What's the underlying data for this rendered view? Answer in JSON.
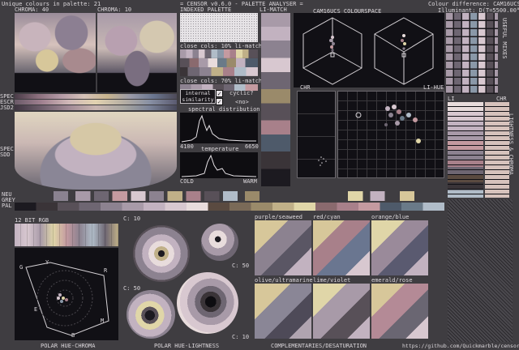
{
  "header": {
    "unique_colours": "Unique colours in palette: 21",
    "app_title": "= CENSOR v0.6.0 - PALETTE ANALYSER =",
    "colour_difference": "Colour difference: CAM16UCS",
    "illuminant": "Illuminant: D(T=5500.00°K)"
  },
  "labels": {
    "chroma40": "CHROMA: 40",
    "chroma10": "CHROMA: 10",
    "indexed_palette": "INDEXED PALETTE",
    "li_match": "LI-MATCH",
    "cam16ucs": "CAM16UCS COLOURSPACE",
    "useful_mixes": "USEFUL MIXES",
    "lightness_chroma": "LIGHTNESS & CHROMA",
    "spec": "SPEC",
    "escr": "ESCR",
    "jsd2": "JSD2",
    "spec2": "SPEC",
    "sdd": "SDD",
    "close_cols_10": "close cols: 10% li-match",
    "close_cols_70": "close cols: 70% li-match",
    "internal_similarity": "internal similarity",
    "cyclic": "cyclic?",
    "no": "<no>",
    "spectral": "spectral distribution",
    "spec_lo": "4100",
    "spec_hi": "6650",
    "temperature": "temperature",
    "cold": "COLD",
    "warm": "WARM",
    "chr": "CHR",
    "li_hue": "LI-HUE",
    "li": "LI",
    "chr2": "CHR",
    "neu": "NEU",
    "grey": "GREY",
    "pal": "PAL",
    "bit_rgb": "12 BIT RGB",
    "c10a": "C: 10",
    "c50a": "C: 50",
    "c50b": "C: 50",
    "c10b": "C: 10",
    "purple_seaweed": "purple/seaweed",
    "red_cyan": "red/cyan",
    "orange_blue": "orange/blue",
    "olive_ultramarine": "olive/ultramarine",
    "lime_violet": "lime/violet",
    "emerald_rose": "emerald/rose",
    "polar_hue_chroma": "POLAR HUE-CHROMA",
    "polar_hue_lightness": "POLAR HUE-LIGHTNESS",
    "complementaries": "COMPLEMENTARIES/DESATURATION",
    "github": "https://github.com/Quickmarble/censor",
    "wheel_g": "G",
    "wheel_y": "Y",
    "wheel_r": "R",
    "wheel_e": "E",
    "wheel_m": "M",
    "wheel_b": "B"
  },
  "palette": [
    "#1c1a20",
    "#3a3438",
    "#585058",
    "#6e6672",
    "#8c8290",
    "#a89aa8",
    "#c2b2c0",
    "#d8c8d0",
    "#e8dcdc",
    "#5a4a40",
    "#7a6a58",
    "#9a8a6a",
    "#c0b088",
    "#e0d6a8",
    "#8a6a6e",
    "#a8808a",
    "#c49aa0",
    "#4e5a6a",
    "#6a7a88",
    "#8a98a8",
    "#b0bcc8"
  ],
  "colors": {
    "bg": "#3f3d41",
    "panel": "#111015",
    "text": "#dcd8dc",
    "accent_sand": "#d7c79a",
    "accent_rose": "#b48a96",
    "accent_slate": "#6a7690"
  }
}
